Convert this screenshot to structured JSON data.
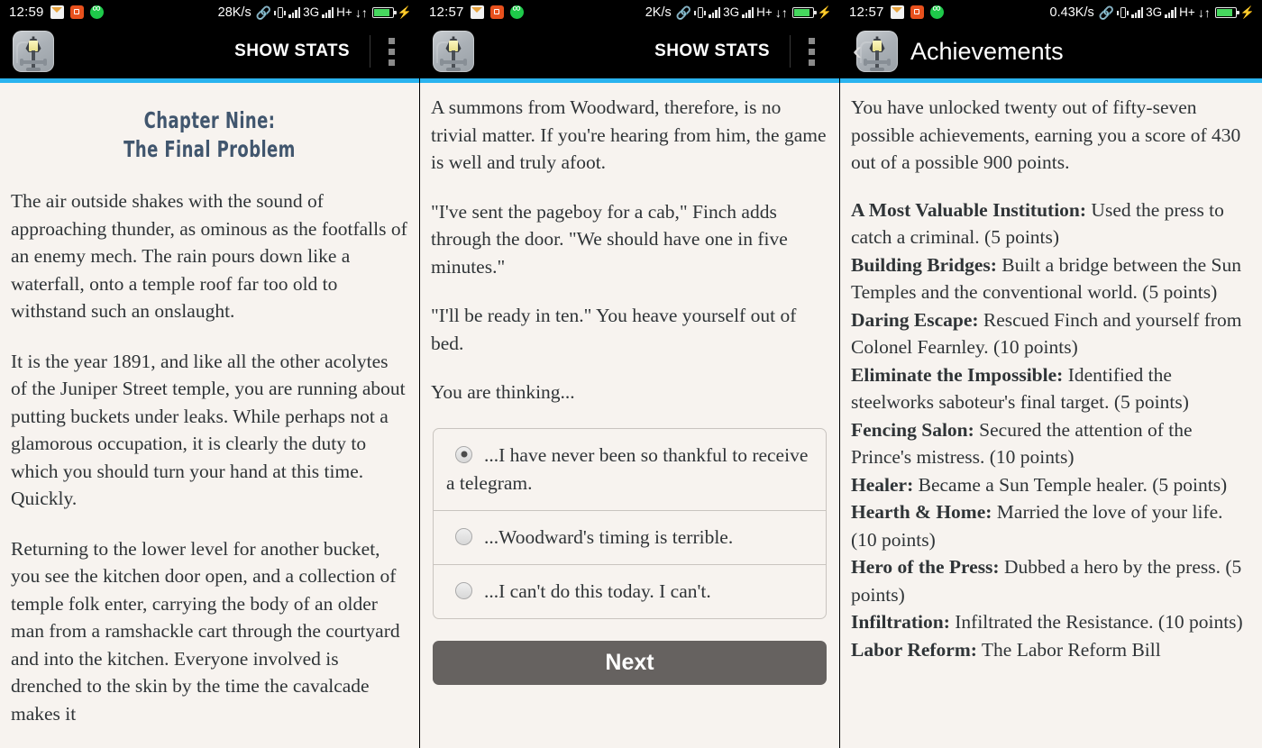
{
  "panels": [
    {
      "status": {
        "clock": "12:59",
        "speed": "28K/s",
        "network": "3G",
        "hsdpa": "H+"
      },
      "toolbar": {
        "stats_label": "SHOW STATS",
        "app_icon": "streetlamp-icon",
        "menu_icon": "kebab-menu-icon"
      },
      "accent_color": "#2ab3ef",
      "chapter": {
        "line1": "Chapter Nine:",
        "line2": "The Final Problem"
      },
      "paragraphs": [
        "The air outside shakes with the sound of approaching thunder, as ominous as the footfalls of an enemy mech. The rain pours down like a waterfall, onto a temple roof far too old to withstand such an onslaught.",
        "It is the year 1891, and like all the other acolytes of the Juniper Street temple, you are running about putting buckets under leaks. While perhaps not a glamorous occupation, it is clearly the duty to which you should turn your hand at this time. Quickly.",
        "Returning to the lower level for another bucket, you see the kitchen door open, and a collection of temple folk enter, carrying the body of an older man from a ramshackle cart through the courtyard and into the kitchen. Everyone involved is drenched to the skin by the time the cavalcade makes it"
      ]
    },
    {
      "status": {
        "clock": "12:57",
        "speed": "2K/s",
        "network": "3G",
        "hsdpa": "H+"
      },
      "toolbar": {
        "stats_label": "SHOW STATS",
        "app_icon": "streetlamp-icon",
        "menu_icon": "kebab-menu-icon"
      },
      "accent_color": "#2ab3ef",
      "paragraphs": [
        "A summons from Woodward, therefore, is no trivial matter. If you're hearing from him, the game is well and truly afoot.",
        "\"I've sent the pageboy for a cab,\" Finch adds through the door. \"We should have one in five minutes.\"",
        "\"I'll be ready in ten.\" You heave yourself out of bed.",
        "You are thinking..."
      ],
      "choices": [
        {
          "label": "...I have never been so thankful to receive a telegram.",
          "selected": true
        },
        {
          "label": "...Woodward's timing is terrible.",
          "selected": false
        },
        {
          "label": "...I can't do this today. I can't.",
          "selected": false
        }
      ],
      "next_label": "Next"
    },
    {
      "status": {
        "clock": "12:57",
        "speed": "0.43K/s",
        "network": "3G",
        "hsdpa": "H+"
      },
      "toolbar": {
        "title": "Achievements",
        "back_icon": "back-chevron-icon",
        "app_icon": "streetlamp-icon"
      },
      "accent_color": "#2ab3ef",
      "intro": "You have unlocked twenty out of fifty-seven possible achievements, earning you a score of 430 out of a possible 900 points.",
      "score": {
        "unlocked": "twenty",
        "total": "fifty-seven",
        "points": "430",
        "max_points": "900"
      },
      "achievements": [
        {
          "name": "A Most Valuable Institution:",
          "desc": " Used the press to catch a criminal. (5 points)"
        },
        {
          "name": "Building Bridges:",
          "desc": " Built a bridge between the Sun Temples and the conventional world. (5 points)"
        },
        {
          "name": "Daring Escape:",
          "desc": " Rescued Finch and yourself from Colonel Fearnley. (10 points)"
        },
        {
          "name": "Eliminate the Impossible:",
          "desc": " Identified the steelworks saboteur's final target. (5 points)"
        },
        {
          "name": "Fencing Salon:",
          "desc": " Secured the attention of the Prince's mistress. (10 points)"
        },
        {
          "name": "Healer:",
          "desc": " Became a Sun Temple healer. (5 points)"
        },
        {
          "name": "Hearth & Home:",
          "desc": " Married the love of your life. (10 points)"
        },
        {
          "name": "Hero of the Press:",
          "desc": " Dubbed a hero by the press. (5 points)"
        },
        {
          "name": "Infiltration:",
          "desc": " Infiltrated the Resistance. (10 points)"
        },
        {
          "name": "Labor Reform:",
          "desc": " The Labor Reform Bill"
        }
      ]
    }
  ]
}
